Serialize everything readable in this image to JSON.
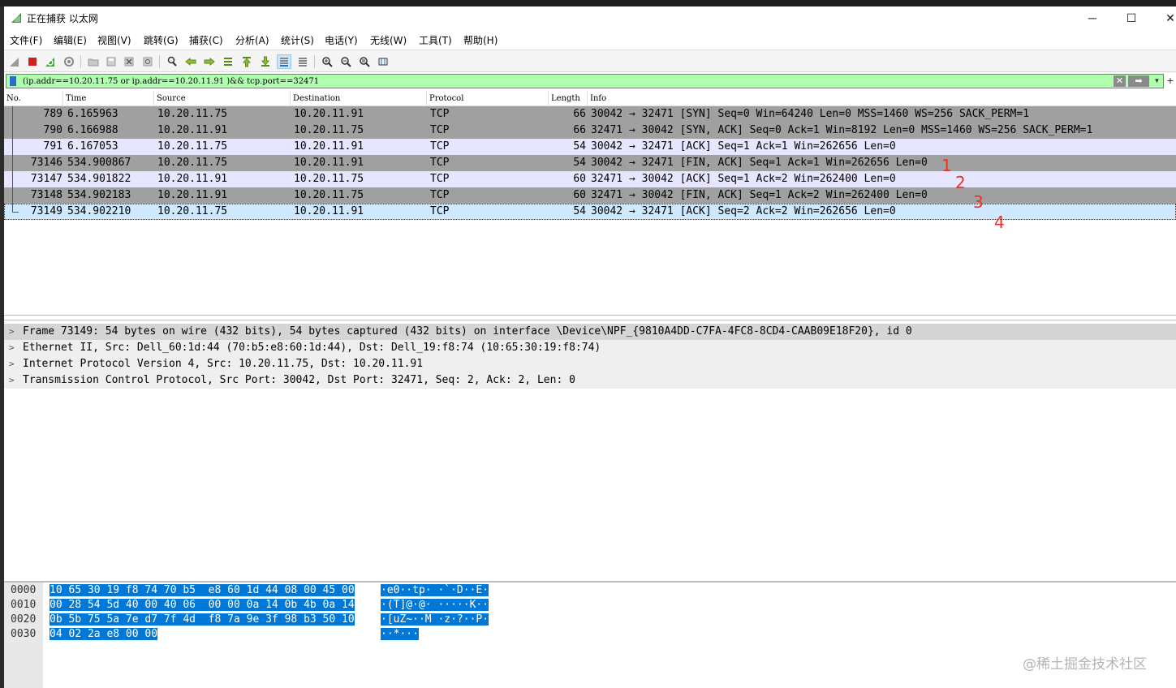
{
  "window": {
    "title": "正在捕获 以太网",
    "minimize_glyph": "─",
    "maximize_glyph": "☐",
    "close_glyph": "✕"
  },
  "menu": [
    "文件(F)",
    "编辑(E)",
    "视图(V)",
    "跳转(G)",
    "捕获(C)",
    "分析(A)",
    "统计(S)",
    "电话(Y)",
    "无线(W)",
    "工具(T)",
    "帮助(H)"
  ],
  "toolbar_icons": [
    "shark-fin-icon",
    "stop-capture-icon",
    "restart-capture-icon",
    "capture-options-icon",
    "open-file-icon",
    "save-file-icon",
    "close-file-icon",
    "reload-file-icon",
    "find-packet-icon",
    "go-back-icon",
    "go-forward-icon",
    "go-to-packet-icon",
    "go-first-icon",
    "go-last-icon",
    "auto-scroll-icon",
    "colorize-icon",
    "zoom-in-icon",
    "zoom-out-icon",
    "zoom-normal-icon",
    "resize-columns-icon"
  ],
  "filter": {
    "value": "(ip.addr==10.20.11.75 or ip.addr==10.20.11.91 )&& tcp.port==32471",
    "clear_glyph": "✕",
    "apply_glyph": "➡",
    "dropdown_glyph": "▼",
    "add_glyph": "+",
    "background": "#afffaf"
  },
  "packet_list": {
    "columns": [
      "No.",
      "Time",
      "Source",
      "Destination",
      "Protocol",
      "Length",
      "Info"
    ],
    "rows": [
      {
        "no": "789",
        "time": "6.165963",
        "src": "10.20.11.75",
        "dst": "10.20.11.91",
        "proto": "TCP",
        "len": "66",
        "info": "30042 → 32471 [SYN] Seq=0 Win=64240 Len=0 MSS=1460 WS=256 SACK_PERM=1"
      },
      {
        "no": "790",
        "time": "6.166988",
        "src": "10.20.11.91",
        "dst": "10.20.11.75",
        "proto": "TCP",
        "len": "66",
        "info": "32471 → 30042 [SYN, ACK] Seq=0 Ack=1 Win=8192 Len=0 MSS=1460 WS=256 SACK_PERM=1"
      },
      {
        "no": "791",
        "time": "6.167053",
        "src": "10.20.11.75",
        "dst": "10.20.11.91",
        "proto": "TCP",
        "len": "54",
        "info": "30042 → 32471 [ACK] Seq=1 Ack=1 Win=262656 Len=0"
      },
      {
        "no": "73146",
        "time": "534.900867",
        "src": "10.20.11.75",
        "dst": "10.20.11.91",
        "proto": "TCP",
        "len": "54",
        "info": "30042 → 32471 [FIN, ACK] Seq=1 Ack=1 Win=262656 Len=0"
      },
      {
        "no": "73147",
        "time": "534.901822",
        "src": "10.20.11.91",
        "dst": "10.20.11.75",
        "proto": "TCP",
        "len": "60",
        "info": "32471 → 30042 [ACK] Seq=1 Ack=2 Win=262400 Len=0"
      },
      {
        "no": "73148",
        "time": "534.902183",
        "src": "10.20.11.91",
        "dst": "10.20.11.75",
        "proto": "TCP",
        "len": "60",
        "info": "32471 → 30042 [FIN, ACK] Seq=1 Ack=2 Win=262400 Len=0"
      },
      {
        "no": "73149",
        "time": "534.902210",
        "src": "10.20.11.75",
        "dst": "10.20.11.91",
        "proto": "TCP",
        "len": "54",
        "info": "30042 → 32471 [ACK] Seq=2 Ack=2 Win=262656 Len=0"
      }
    ],
    "annotations": [
      "1",
      "2",
      "3",
      "4"
    ],
    "annotation_color": "#e8332b"
  },
  "details": [
    "Frame 73149: 54 bytes on wire (432 bits), 54 bytes captured (432 bits) on interface \\Device\\NPF_{9810A4DD-C7FA-4FC8-8CD4-CAAB09E18F20}, id 0",
    "Ethernet II, Src: Dell_60:1d:44 (70:b5:e8:60:1d:44), Dst: Dell_19:f8:74 (10:65:30:19:f8:74)",
    "Internet Protocol Version 4, Src: 10.20.11.75, Dst: 10.20.11.91",
    "Transmission Control Protocol, Src Port: 30042, Dst Port: 32471, Seq: 2, Ack: 2, Len: 0"
  ],
  "bytes": {
    "offsets": [
      "0000",
      "0010",
      "0020",
      "0030"
    ],
    "hex": [
      "10 65 30 19 f8 74 70 b5  e8 60 1d 44 08 00 45 00",
      "00 28 54 5d 40 00 40 06  00 00 0a 14 0b 4b 0a 14",
      "0b 5b 75 5a 7e d7 7f 4d  f8 7a 9e 3f 98 b3 50 10",
      "04 02 2a e8 00 00"
    ],
    "ascii": [
      "·e0··tp· ·`·D··E·",
      "·(T]@·@· ·····K··",
      "·[uZ~··M ·z·?··P·",
      "··*···"
    ],
    "highlight_color": "#0078d7"
  },
  "watermark": "@稀土掘金技术社区"
}
